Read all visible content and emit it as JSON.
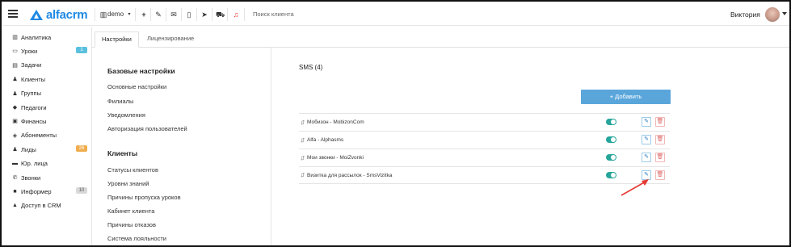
{
  "header": {
    "logo_text": "alfacrm",
    "account": "demo",
    "search_placeholder": "Поиск клиента",
    "user_name": "Виктория",
    "icons": [
      "plus-icon",
      "wrench-icon",
      "mail-icon",
      "phone-icon",
      "send-icon",
      "bell-icon"
    ]
  },
  "sidebar": {
    "items": [
      {
        "icon": "▥",
        "label": "Аналитика"
      },
      {
        "icon": "▭",
        "label": "Уроки",
        "badge": "1",
        "badge_color": "#5bc0de"
      },
      {
        "icon": "▤",
        "label": "Задачи"
      },
      {
        "icon": "♟",
        "label": "Клиенты"
      },
      {
        "icon": "♟",
        "label": "Группы"
      },
      {
        "icon": "◆",
        "label": "Педагоги"
      },
      {
        "icon": "▣",
        "label": "Финансы"
      },
      {
        "icon": "◈",
        "label": "Абонементы"
      },
      {
        "icon": "♟",
        "label": "Лиды",
        "badge": "26",
        "badge_color": "#f0ad4e"
      },
      {
        "icon": "▬",
        "label": "Юр. лица"
      },
      {
        "icon": "✆",
        "label": "Звонки"
      },
      {
        "icon": "■",
        "label": "Информер",
        "badge": "10",
        "badge_color": "#d9d9d9"
      },
      {
        "icon": "▲",
        "label": "Доступ в CRM"
      }
    ]
  },
  "tabs": [
    "Настройки",
    "Лицензирование"
  ],
  "settings_nav": {
    "section1_title": "Базовые настройки",
    "section1_links": [
      "Основные настройки",
      "Филиалы",
      "Уведомления",
      "Авторизация пользователей"
    ],
    "section2_title": "Клиенты",
    "section2_links": [
      "Статусы клиентов",
      "Уровни знаний",
      "Причины пропуска уроков",
      "Кабинет клиента",
      "Причины отказов",
      "Система лояльности"
    ]
  },
  "main": {
    "title": "SMS (4)",
    "add_button": "+ Добавить",
    "drag_glyph": "⇵",
    "edit_glyph": "✎",
    "delete_glyph": "🗑",
    "rows": [
      {
        "label": "Мобизон - MobizonCom",
        "enabled": true
      },
      {
        "label": "Alfa - Alphasms",
        "enabled": true
      },
      {
        "label": "Мои звонки - MoiZvonki",
        "enabled": true
      },
      {
        "label": "Визитка для рассылок - SmsVizitka",
        "enabled": true
      }
    ]
  },
  "colors": {
    "accent": "#1e88e5",
    "add_button": "#5aa6db",
    "toggle_on": "#26a69a",
    "annotation_arrow": "#e53935"
  }
}
